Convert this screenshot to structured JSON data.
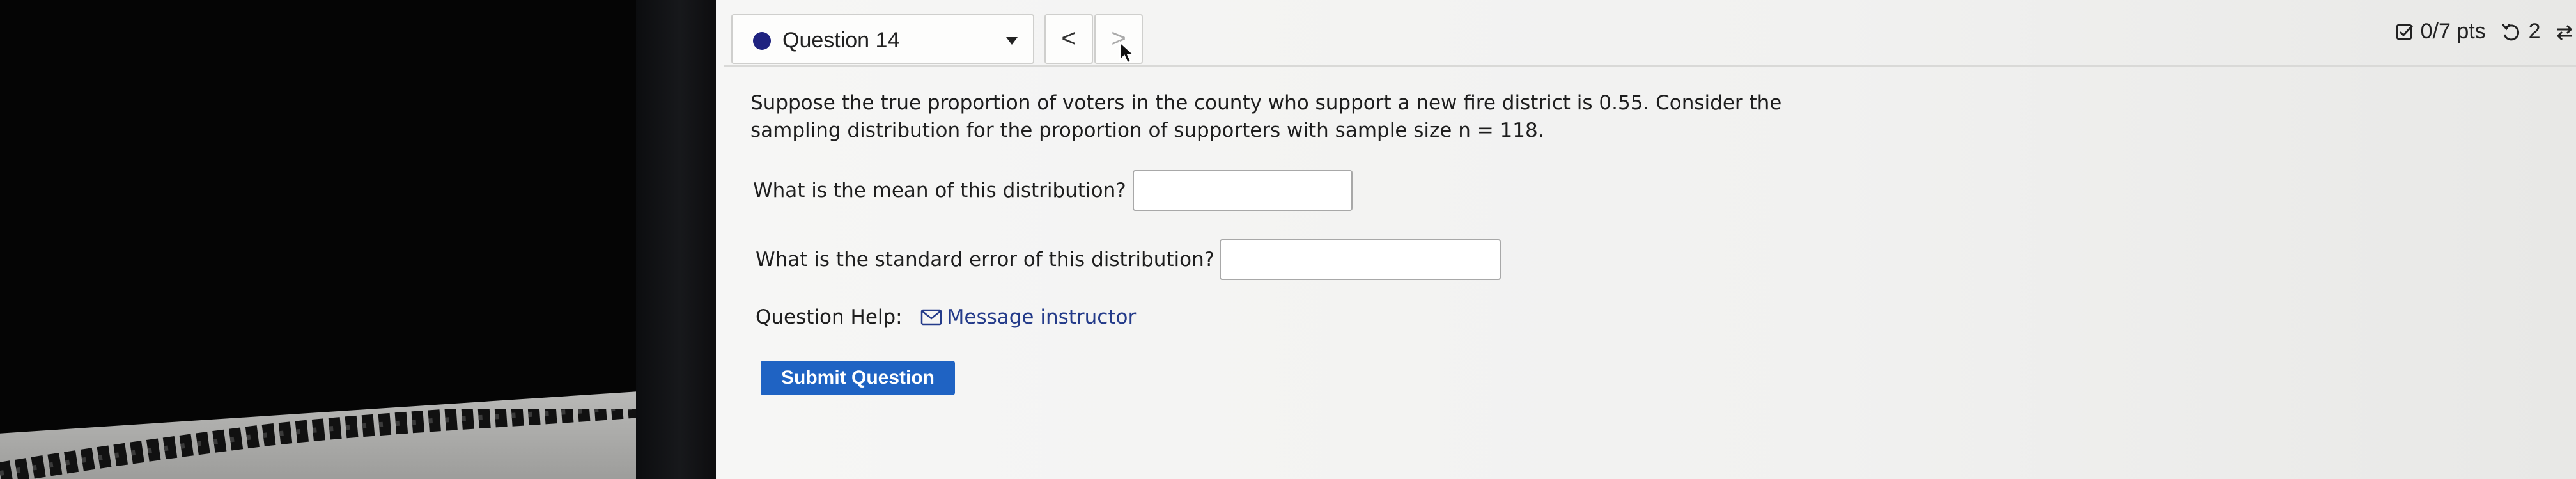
{
  "question_nav": {
    "label": "Question 14",
    "prev_glyph": "<",
    "next_glyph": ">"
  },
  "score": {
    "points": "0/7 pts",
    "attempts": "2"
  },
  "question": {
    "text": "Suppose the true proportion of voters in the county who support a new fire district is 0.55. Consider the sampling distribution for the proportion of supporters with sample size n = 118.",
    "parts": [
      {
        "prompt": "What is the mean of this distribution?",
        "value": ""
      },
      {
        "prompt": "What is the standard error of this distribution?",
        "value": ""
      }
    ]
  },
  "help": {
    "label": "Question Help:",
    "message_link": "Message instructor"
  },
  "submit_label": "Submit Question",
  "colors": {
    "status_dot": "#1f2380",
    "submit_button": "#1f63c3",
    "link": "#243b8a"
  },
  "icons": [
    "caret-down-icon",
    "chevron-left-icon",
    "chevron-right-icon",
    "mouse-cursor-icon",
    "checkbox-icon",
    "retry-icon",
    "sync-icon",
    "mail-icon"
  ]
}
